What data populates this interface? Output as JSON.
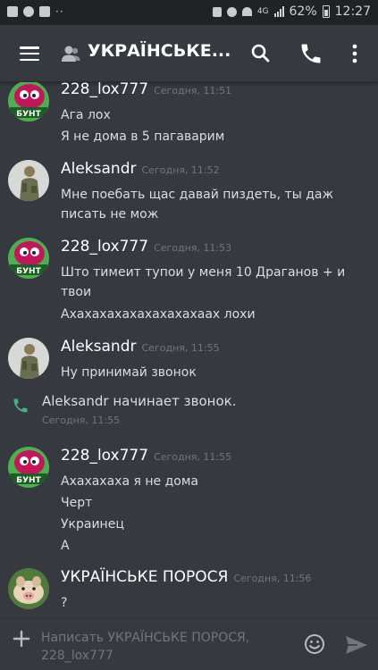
{
  "status_bar": {
    "network": "4G",
    "battery_percent": "62%",
    "time": "12:27"
  },
  "header": {
    "title": "УКРАЇНСЬКЕ..."
  },
  "messages": [
    {
      "author": "228_lox777",
      "time": "Сегодня, 11:51",
      "lines": [
        "Ага лох",
        "Я не дома в 5 пагаварим"
      ],
      "avatar": "bunt"
    },
    {
      "author": "Aleksandr",
      "time": "Сегодня, 11:52",
      "lines": [
        "Мне поебать щас давай пиздеть, ты даж писать не мож"
      ],
      "avatar": "soldier"
    },
    {
      "author": "228_lox777",
      "time": "Сегодня, 11:53",
      "lines": [
        "Што тимеит тупои у меня 10 Драганов + и твои",
        "Ахахахахахахахахахаах лохи"
      ],
      "avatar": "bunt"
    },
    {
      "author": "Aleksandr",
      "time": "Сегодня, 11:55",
      "lines": [
        "Ну принимай звонок"
      ],
      "avatar": "soldier"
    },
    {
      "author": "228_lox777",
      "time": "Сегодня, 11:55",
      "lines": [
        "Ахахахаха я не дома",
        "Черт",
        "Украинец",
        "А"
      ],
      "avatar": "bunt"
    },
    {
      "author": "УКРАЇНСЬКЕ ПОРОСЯ",
      "time": "Сегодня, 11:56",
      "lines": [
        "?"
      ],
      "avatar": "pig"
    }
  ],
  "call_notice": {
    "text": "Aleksandr начинает звонок.",
    "time": "Сегодня, 11:55"
  },
  "avatar_badge": "БУНТ",
  "composer": {
    "placeholder_line1": "Написать УКРАЇНСЬКЕ ПОРОСЯ,",
    "placeholder_line2": "228_lox777"
  },
  "colors": {
    "background": "#36393f",
    "call_green": "#43b581",
    "timestamp_gray": "#72767d"
  }
}
